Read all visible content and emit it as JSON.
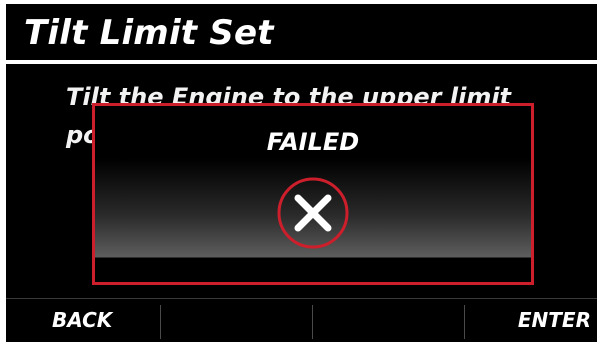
{
  "header": {
    "title": "Tilt Limit Set"
  },
  "main": {
    "instruction": "Tilt the Engine to the upper limit position"
  },
  "dialog": {
    "title": "FAILED",
    "icon": "close-x-icon",
    "border_color": "#cc1f2b"
  },
  "softkeys": {
    "back_label": "BACK",
    "key2_label": "",
    "key3_label": "",
    "enter_label": "ENTER"
  }
}
